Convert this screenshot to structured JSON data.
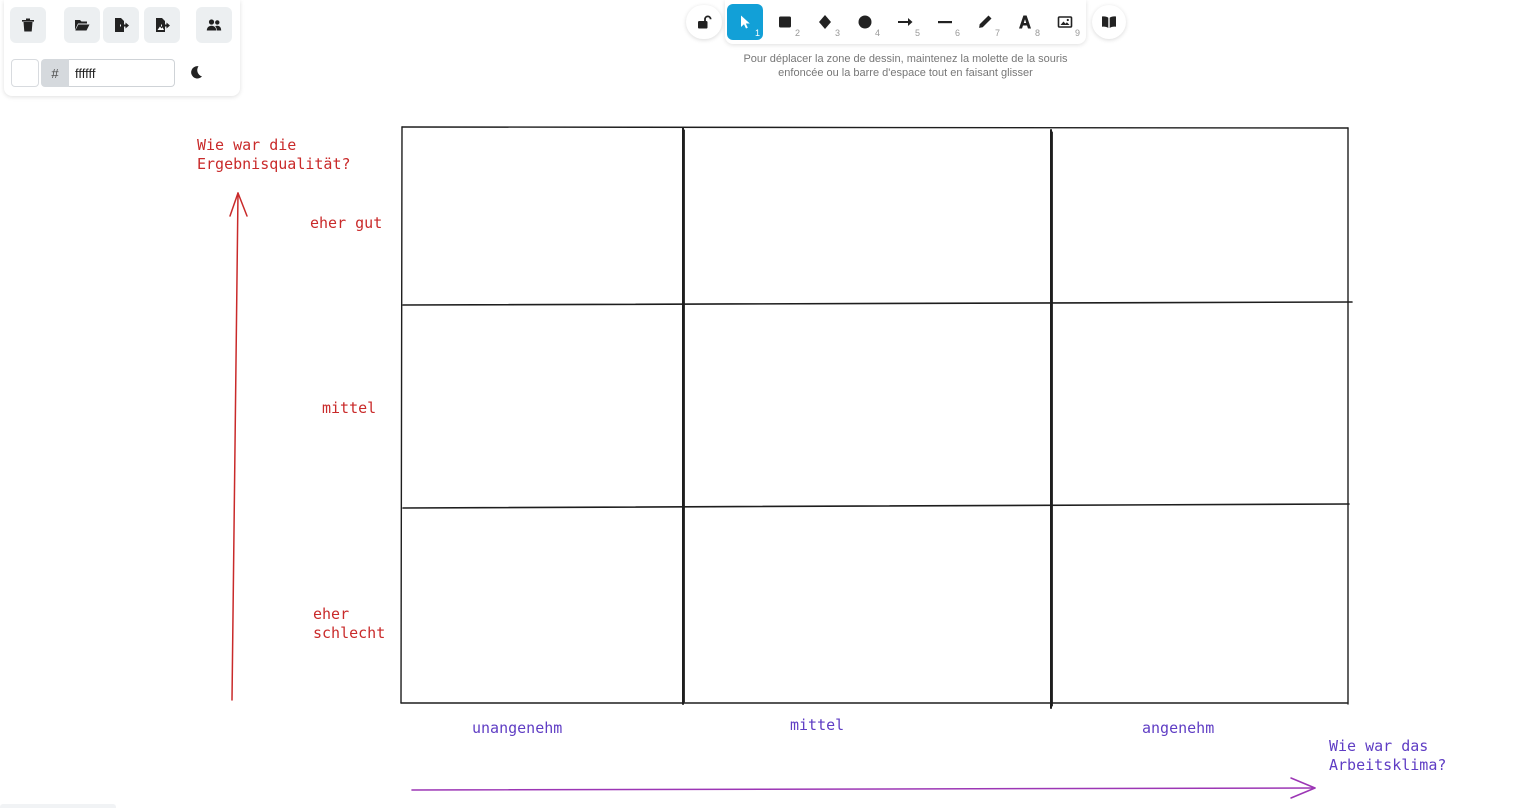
{
  "left_panel": {
    "buttons": [
      {
        "name": "delete-button",
        "icon": "trash-icon"
      },
      {
        "name": "open-button",
        "icon": "folder-open-icon"
      },
      {
        "name": "export-button",
        "icon": "file-export-icon"
      },
      {
        "name": "export-image-button",
        "icon": "image-export-icon"
      },
      {
        "name": "collaboration-button",
        "icon": "users-icon"
      }
    ],
    "background_color": {
      "hash_symbol": "#",
      "value": "ffffff",
      "swatch_color": "#ffffff"
    },
    "dark_mode_icon": "moon-icon"
  },
  "toolbar": {
    "lock_icon": "unlock-icon",
    "tools": [
      {
        "name": "selection",
        "icon": "cursor-icon",
        "shortcut": "1",
        "active": true
      },
      {
        "name": "rectangle",
        "icon": "square-icon",
        "shortcut": "2"
      },
      {
        "name": "diamond",
        "icon": "diamond-icon",
        "shortcut": "3"
      },
      {
        "name": "ellipse",
        "icon": "circle-icon",
        "shortcut": "4"
      },
      {
        "name": "arrow",
        "icon": "arrow-right-icon",
        "shortcut": "5"
      },
      {
        "name": "line",
        "icon": "line-icon",
        "shortcut": "6"
      },
      {
        "name": "draw",
        "icon": "pencil-icon",
        "shortcut": "7"
      },
      {
        "name": "text",
        "icon": "text-icon",
        "shortcut": "8"
      },
      {
        "name": "image",
        "icon": "image-icon",
        "shortcut": "9"
      }
    ],
    "library_icon": "book-icon",
    "active_color": "#12a0d7",
    "hint": "Pour déplacer la zone de dessin, maintenez la molette de la souris enfoncée ou la barre d'espace tout en faisant glisser"
  },
  "canvas": {
    "y_axis_title": "Wie war die\nErgebnisqualität?",
    "y_labels": [
      "eher gut",
      "mittel",
      "eher\nschlecht"
    ],
    "x_labels": [
      "unangenehm",
      "mittel",
      "angenehm"
    ],
    "x_axis_title": "Wie war das\nArbeitsklima?",
    "colors": {
      "red": "#c92a2a",
      "violet": "#5f3dc4",
      "x_arrow": "#9c36b5",
      "grid": "#1e1e1e"
    }
  }
}
